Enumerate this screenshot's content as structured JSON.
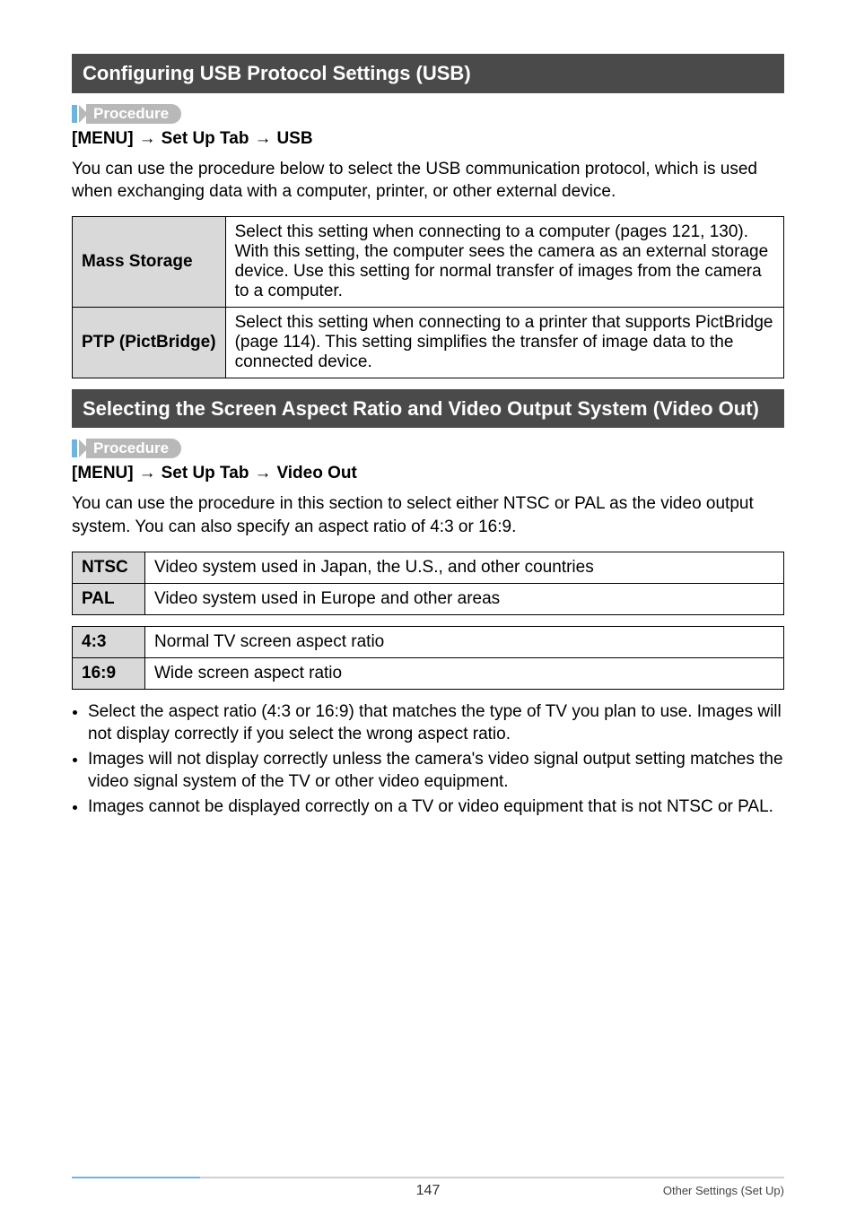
{
  "procedure_label": "Procedure",
  "arrow": "→",
  "section_usb": {
    "title": "Configuring USB Protocol Settings (USB)",
    "path": [
      "[MENU]",
      "Set Up Tab",
      "USB"
    ],
    "intro": "You can use the procedure below to select the USB communication protocol, which is used when exchanging data with a computer, printer, or other external device.",
    "rows": [
      {
        "head": "Mass Storage",
        "cell": "Select this setting when connecting to a computer (pages 121, 130). With this setting, the computer sees the camera as an external storage device. Use this setting for normal transfer of images from the camera to a computer."
      },
      {
        "head": "PTP (PictBridge)",
        "cell": "Select this setting when connecting to a printer that supports PictBridge (page 114). This setting simplifies the transfer of image data to the connected device."
      }
    ]
  },
  "section_video": {
    "title": "Selecting the Screen Aspect Ratio and Video Output System (Video Out)",
    "path": [
      "[MENU]",
      "Set Up Tab",
      "Video Out"
    ],
    "intro": "You can use the procedure in this section to select either NTSC or PAL as the video output system. You can also specify an aspect ratio of 4:3 or 16:9.",
    "system_rows": [
      {
        "head": "NTSC",
        "cell": "Video system used in Japan, the U.S., and other countries"
      },
      {
        "head": "PAL",
        "cell": "Video system used in Europe and other areas"
      }
    ],
    "aspect_rows": [
      {
        "head": "4:3",
        "cell": "Normal TV screen aspect ratio"
      },
      {
        "head": "16:9",
        "cell": "Wide screen aspect ratio"
      }
    ],
    "notes": [
      "Select the aspect ratio (4:3 or 16:9) that matches the type of TV you plan to use. Images will not display correctly if you select the wrong aspect ratio.",
      "Images will not display correctly unless the camera's video signal output setting matches the video signal system of the TV or other video equipment.",
      "Images cannot be displayed correctly on a TV or video equipment that is not NTSC or PAL."
    ]
  },
  "footer": {
    "page": "147",
    "crumb": "Other Settings (Set Up)"
  }
}
